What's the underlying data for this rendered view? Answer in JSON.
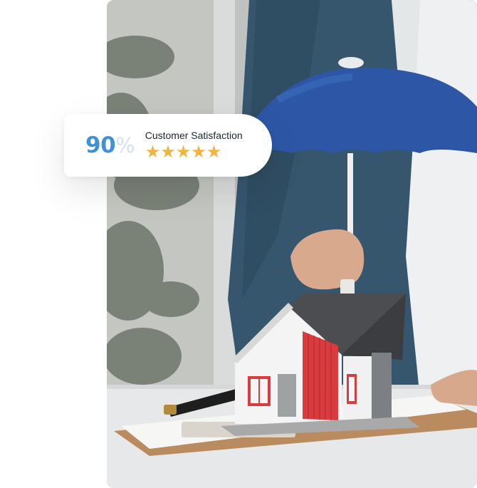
{
  "badge": {
    "percent_value": "90",
    "percent_sign": "%",
    "label": "Customer Satisfaction",
    "rating": 5,
    "star_glyph": "★"
  },
  "colors": {
    "percent": "#3f92d6",
    "percent_sign": "#d2e2f3",
    "stars": "#f3b33d",
    "umbrella": "#2d57a6",
    "house_accent": "#d93b3f"
  },
  "photo": {
    "subject": "hand-holding-umbrella-over-house-model"
  }
}
